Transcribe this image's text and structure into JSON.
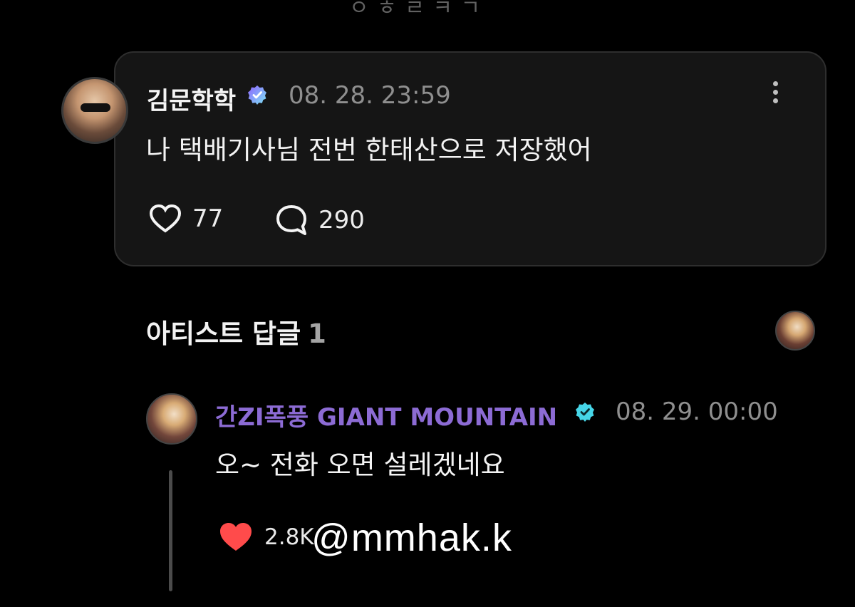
{
  "post": {
    "author": "김문학학",
    "timestamp": "08. 28. 23:59",
    "text": "나 택배기사님 전번 한태산으로 저장했어",
    "likes": "77",
    "comments": "290",
    "icons": {
      "verified": "verified-badge-icon",
      "more": "more-vertical-icon",
      "like": "heart-outline-icon",
      "comment": "speech-bubble-icon"
    },
    "colors": {
      "card_background": "#151515",
      "verified_gradient_start": "#8f63ff",
      "verified_gradient_end": "#7de6f5"
    }
  },
  "artist_replies": {
    "label": "아티스트 답글",
    "count": "1"
  },
  "reply": {
    "author": "간ZI폭풍 GIANT MOUNTAIN",
    "timestamp": "08. 29. 00:00",
    "text": "오~ 전화 오면 설레겠네요",
    "likes": "2.8K",
    "icons": {
      "verified": "verified-badge-icon",
      "like": "heart-filled-icon"
    },
    "colors": {
      "author": "#8c6bd4",
      "heart": "#ff4b4b",
      "verified": "#46d6e8"
    }
  },
  "top_fragment": "ㅇ ㅎ ㄹ ㅋ ㄱ",
  "watermark": "@mmhak.k"
}
